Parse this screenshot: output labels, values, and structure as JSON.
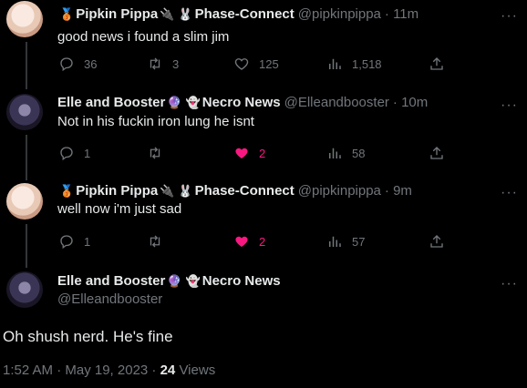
{
  "tweets": [
    {
      "name": "Pipkin Pippa",
      "badge_emojis": [
        "🥉"
      ],
      "name_suffix_emojis": [
        "🔌",
        "🐰"
      ],
      "affiliation": "Phase-Connect",
      "handle": "@pipkinpippa",
      "time": "· 11m",
      "text": "good news i found a slim jim",
      "replies": "36",
      "retweets": "3",
      "likes": "125",
      "views": "1,518",
      "liked": false
    },
    {
      "name": "Elle and Booster",
      "name_suffix_emojis": [
        "🔮",
        "👻"
      ],
      "affiliation": "Necro News",
      "handle": "@Elleandbooster",
      "time": "· 10m",
      "text": "Not in his fuckin iron lung he isnt",
      "replies": "1",
      "retweets": "",
      "likes": "2",
      "views": "58",
      "liked": true
    },
    {
      "name": "Pipkin Pippa",
      "badge_emojis": [
        "🥉"
      ],
      "name_suffix_emojis": [
        "🔌",
        "🐰"
      ],
      "affiliation": "Phase-Connect",
      "handle": "@pipkinpippa",
      "time": "· 9m",
      "text": "well now i'm just sad",
      "replies": "1",
      "retweets": "",
      "likes": "2",
      "views": "57",
      "liked": true
    }
  ],
  "main_tweet": {
    "name": "Elle and Booster",
    "name_suffix_emojis": [
      "🔮",
      "👻"
    ],
    "affiliation": "Necro News",
    "handle": "@Elleandbooster",
    "text": "Oh shush nerd. He's fine",
    "timestamp": "1:52 AM · May 19, 2023 ·",
    "views_count": "24",
    "views_label": "Views"
  },
  "more_label": "···",
  "colors": {
    "background": "#000000",
    "text": "#e7e9ea",
    "muted": "#71767b",
    "like": "#f91880"
  }
}
